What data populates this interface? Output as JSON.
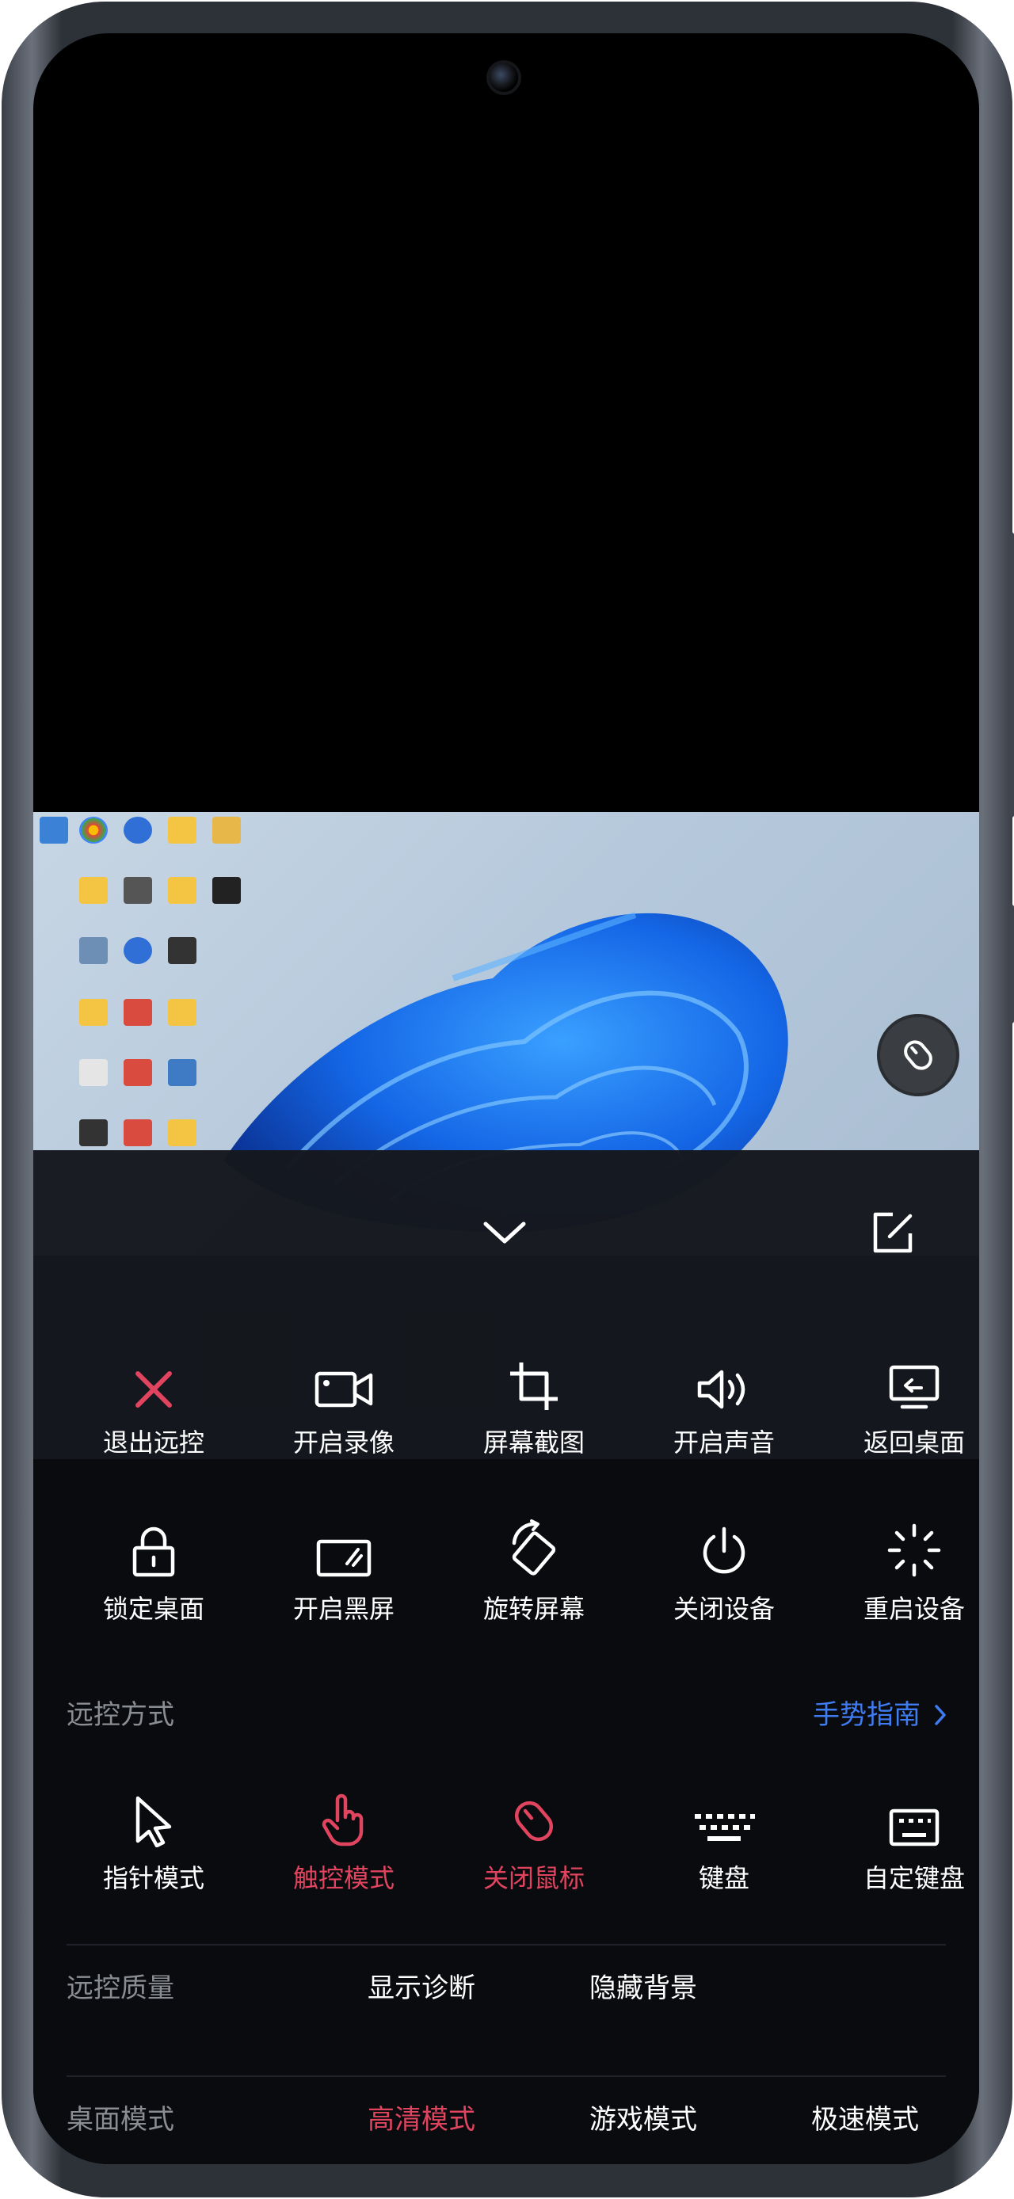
{
  "toolbar_row1": [
    {
      "label": "退出远控",
      "icon": "close-x-icon"
    },
    {
      "label": "开启录像",
      "icon": "video-camera-icon"
    },
    {
      "label": "屏幕截图",
      "icon": "crop-icon"
    },
    {
      "label": "开启声音",
      "icon": "speaker-icon"
    },
    {
      "label": "返回桌面",
      "icon": "monitor-return-icon"
    }
  ],
  "toolbar_row2": [
    {
      "label": "锁定桌面",
      "icon": "lock-icon"
    },
    {
      "label": "开启黑屏",
      "icon": "black-screen-icon"
    },
    {
      "label": "旋转屏幕",
      "icon": "rotate-screen-icon"
    },
    {
      "label": "关闭设备",
      "icon": "power-icon"
    },
    {
      "label": "重启设备",
      "icon": "restart-spinner-icon"
    }
  ],
  "remote_mode": {
    "title": "远控方式",
    "guide_label": "手势指南",
    "items": [
      {
        "label": "指针模式",
        "icon": "pointer-cursor-icon",
        "active": false
      },
      {
        "label": "触控模式",
        "icon": "touch-hand-icon",
        "active": true
      },
      {
        "label": "关闭鼠标",
        "icon": "mouse-icon",
        "active": true
      },
      {
        "label": "键盘",
        "icon": "keyboard-icon",
        "active": false
      },
      {
        "label": "自定键盘",
        "icon": "custom-keyboard-icon",
        "active": false
      }
    ]
  },
  "quality": {
    "title": "远控质量",
    "options": [
      "显示诊断",
      "隐藏背景"
    ]
  },
  "desktop_mode": {
    "title": "桌面模式",
    "options": [
      "高清模式",
      "游戏模式",
      "极速模式"
    ],
    "selected": "高清模式"
  },
  "colors": {
    "accent_red": "#e0445e",
    "link_blue": "#3f7cf2",
    "muted_text": "#8a8d92"
  }
}
